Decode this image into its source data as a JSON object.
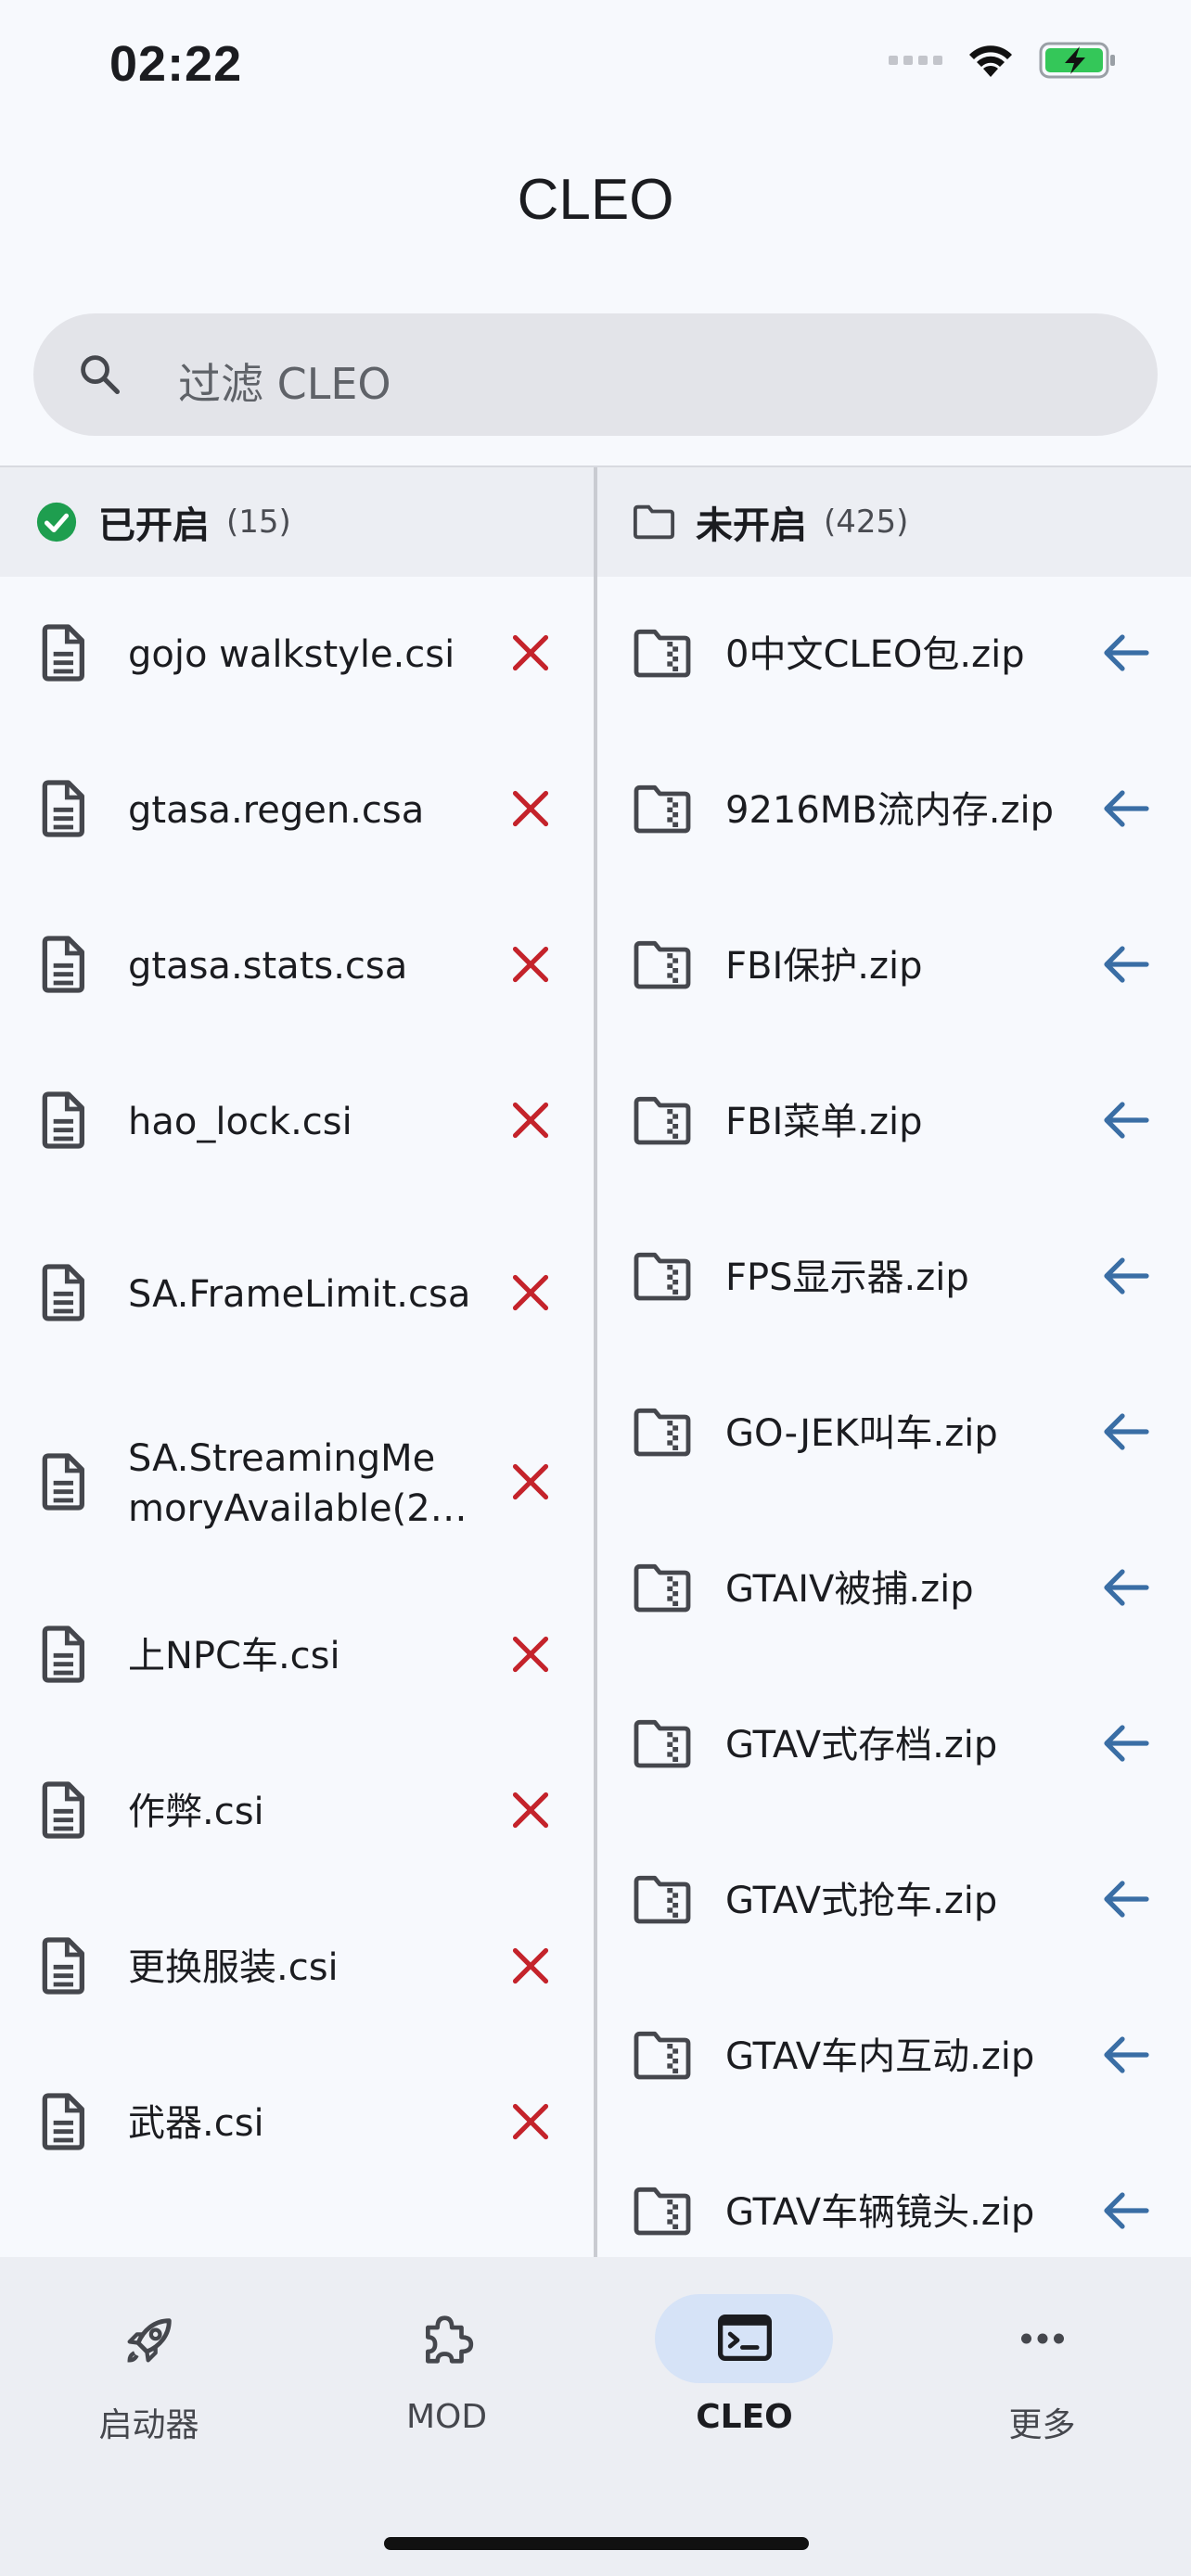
{
  "status": {
    "time": "02:22"
  },
  "header": {
    "title": "CLEO"
  },
  "search": {
    "placeholder": "过滤 CLEO"
  },
  "enabled": {
    "label": "已开启",
    "count": "(15)",
    "items": [
      {
        "name": "gojo walkstyle.csi"
      },
      {
        "name": "gtasa.regen.csa"
      },
      {
        "name": "gtasa.stats.csa"
      },
      {
        "name": "hao_lock.csi"
      },
      {
        "name": "SA.FrameLimit.csa"
      },
      {
        "name": "SA.StreamingMemoryAvailable(2…"
      },
      {
        "name": "上NPC车.csi"
      },
      {
        "name": "作弊.csi"
      },
      {
        "name": "更换服装.csi"
      },
      {
        "name": "武器.csi"
      }
    ]
  },
  "disabled": {
    "label": "未开启",
    "count": "(425)",
    "items": [
      {
        "name": "0中文CLEO包.zip"
      },
      {
        "name": "9216MB流内存.zip"
      },
      {
        "name": "FBI保护.zip"
      },
      {
        "name": "FBI菜单.zip"
      },
      {
        "name": "FPS显示器.zip"
      },
      {
        "name": "GO-JEK叫车.zip"
      },
      {
        "name": "GTAIV被捕.zip"
      },
      {
        "name": "GTAV式存档.zip"
      },
      {
        "name": "GTAV式抢车.zip"
      },
      {
        "name": "GTAV车内互动.zip"
      },
      {
        "name": "GTAV车辆镜头.zip"
      }
    ]
  },
  "nav": [
    {
      "label": "启动器",
      "icon": "rocket-icon"
    },
    {
      "label": "MOD",
      "icon": "puzzle-icon"
    },
    {
      "label": "CLEO",
      "icon": "terminal-icon",
      "active": true
    },
    {
      "label": "更多",
      "icon": "more-icon"
    }
  ],
  "colors": {
    "enabled_check": "#1e9e4f",
    "remove": "#c4232b",
    "enable_arrow": "#3a6ea5",
    "nav_active_pill": "#d6e3f7"
  }
}
